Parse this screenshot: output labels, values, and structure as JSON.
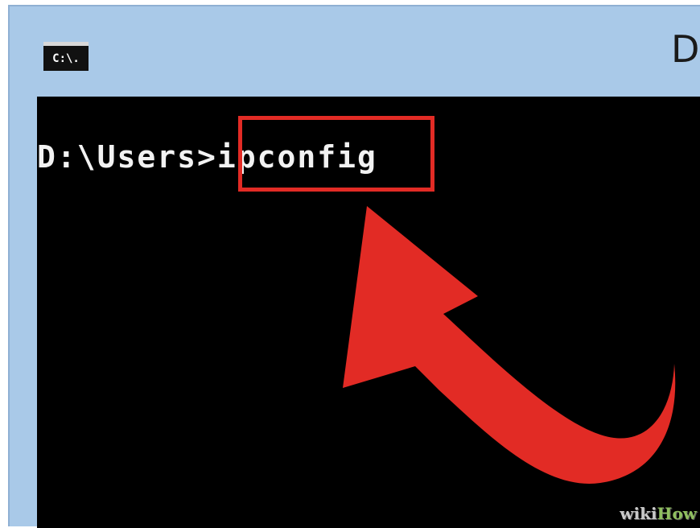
{
  "window": {
    "icon_label": "C:\\.",
    "title_fragment": "D"
  },
  "console": {
    "prompt": "D:\\Users>",
    "command": "ipconfig"
  },
  "annotation": {
    "highlight_color": "#e22b25",
    "arrow_color": "#e22b25"
  },
  "watermark": {
    "part1": "wiki",
    "part2": "How"
  }
}
